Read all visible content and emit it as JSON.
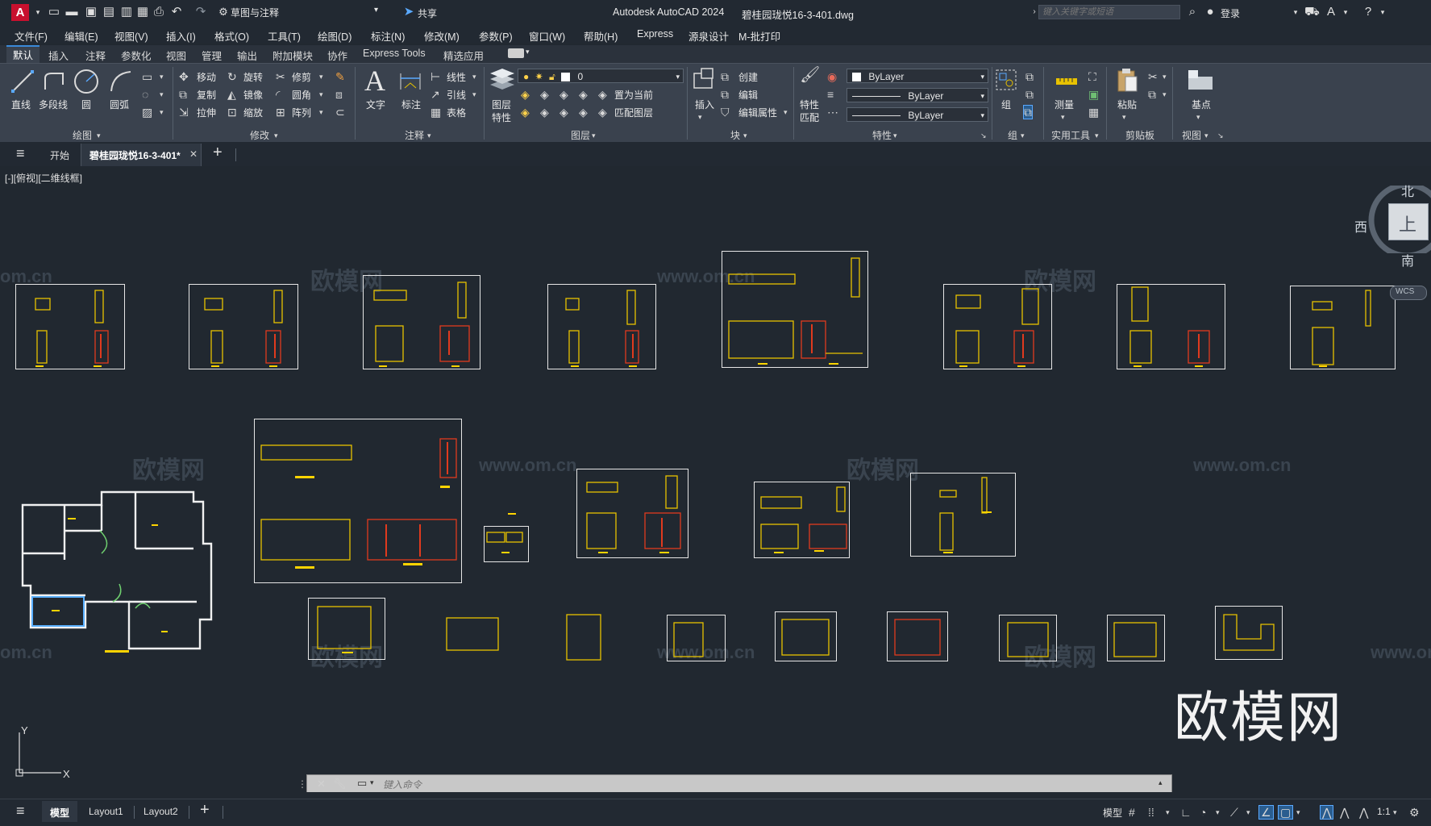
{
  "title_bar": {
    "app_logo": "A",
    "workspace": "草图与注释",
    "share_label": "共享",
    "app_title": "Autodesk AutoCAD 2024",
    "file_name": "碧桂园珑悦16-3-401.dwg",
    "search_placeholder": "键入关键字或短语",
    "login_label": "登录"
  },
  "menu": [
    "文件(F)",
    "编辑(E)",
    "视图(V)",
    "插入(I)",
    "格式(O)",
    "工具(T)",
    "绘图(D)",
    "标注(N)",
    "修改(M)",
    "参数(P)",
    "窗口(W)",
    "帮助(H)",
    "Express",
    "源泉设计",
    "M-批打印"
  ],
  "ribbon_tabs": [
    "默认",
    "插入",
    "注释",
    "参数化",
    "视图",
    "管理",
    "输出",
    "附加模块",
    "协作",
    "Express Tools",
    "精选应用"
  ],
  "ribbon": {
    "draw": {
      "line": "直线",
      "polyline": "多段线",
      "circle": "圆",
      "arc": "圆弧",
      "title": "绘图"
    },
    "modify": {
      "move": "移动",
      "rotate": "旋转",
      "trim": "修剪",
      "copy": "复制",
      "mirror": "镜像",
      "fillet": "圆角",
      "stretch": "拉伸",
      "scale": "缩放",
      "array": "阵列",
      "title": "修改"
    },
    "annotation": {
      "text": "文字",
      "dimension": "标注",
      "linear": "线性",
      "leader": "引线",
      "table": "表格",
      "title": "注释"
    },
    "layers": {
      "layer_properties": "图层\n特性",
      "layer_prop_1": "图层",
      "layer_prop_2": "特性",
      "current_layer": "0",
      "make_current": "置为当前",
      "match_layer": "匹配图层",
      "title": "图层"
    },
    "block": {
      "insert": "插入",
      "create": "创建",
      "edit": "编辑",
      "edit_attr": "编辑属性",
      "title": "块"
    },
    "properties": {
      "match_1": "特性",
      "match_2": "匹配",
      "color": "ByLayer",
      "linetype": "ByLayer",
      "lineweight": "ByLayer",
      "title": "特性"
    },
    "groups": {
      "group": "组",
      "title": "组"
    },
    "utilities": {
      "measure": "测量",
      "title": "实用工具"
    },
    "clipboard": {
      "paste": "粘贴",
      "title": "剪贴板"
    },
    "view": {
      "base": "基点",
      "title": "视图"
    }
  },
  "doc_tabs": {
    "start": "开始",
    "active": "碧桂园珑悦16-3-401*"
  },
  "viewport_label": "[-][俯视][二维线框]",
  "viewcube": {
    "north": "北",
    "west": "西",
    "south": "南",
    "top": "上",
    "wcs": "WCS"
  },
  "watermarks": {
    "cn": "欧模网",
    "url": "www.om.cn",
    "url_partial": "om.cn"
  },
  "ucs": {
    "x": "X",
    "y": "Y"
  },
  "command_placeholder": "键入命令",
  "layout_tabs": [
    "模型",
    "Layout1",
    "Layout2"
  ],
  "status": {
    "model": "模型",
    "scale": "1:1"
  },
  "colors": {
    "canvas": "#212830",
    "ribbon": "#3a424e",
    "accent": "#3a89d8",
    "drawing_yellow": "#e8c200",
    "drawing_red": "#e03a1e",
    "frame": "#e6e6e6"
  }
}
